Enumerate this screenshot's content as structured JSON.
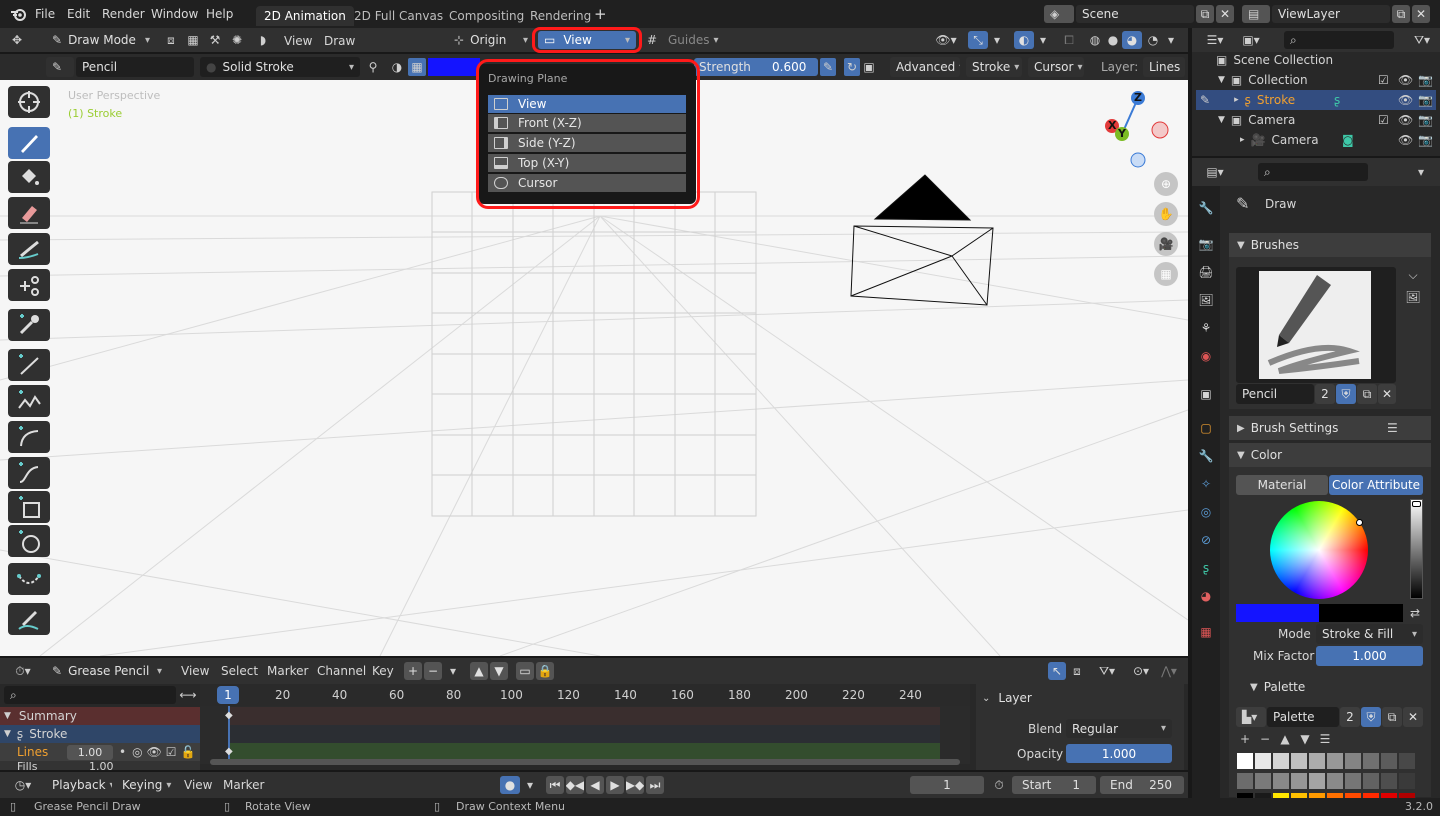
{
  "topbar": {
    "menus": [
      "File",
      "Edit",
      "Render",
      "Window",
      "Help"
    ],
    "workspaces": [
      "2D Animation",
      "2D Full Canvas",
      "Compositing",
      "Rendering"
    ],
    "plus": "+",
    "scene": "Scene",
    "view_layer": "ViewLayer"
  },
  "header": {
    "mode": "Draw Mode",
    "view": "View",
    "draw": "Draw",
    "origin": "Origin",
    "plane": "View",
    "guides": "Guides"
  },
  "tool_settings": {
    "brush": "Pencil",
    "material": "Solid Stroke",
    "strength_label": "Strength",
    "strength": "0.600",
    "advanced": "Advanced",
    "stroke": "Stroke",
    "cursor": "Cursor",
    "layer_label": "Layer:",
    "layer": "Lines"
  },
  "viewport": {
    "perspective": "User Perspective",
    "object": "(1) Stroke",
    "gizmo": {
      "z": "Z",
      "x": "X",
      "y": "Y"
    }
  },
  "drawing_plane": {
    "title": "Drawing Plane",
    "items": [
      {
        "label": "View",
        "icon": "monitor-icon"
      },
      {
        "label": "Front (X-Z)",
        "icon": "front-plane-icon"
      },
      {
        "label": "Side (Y-Z)",
        "icon": "side-plane-icon"
      },
      {
        "label": "Top (X-Y)",
        "icon": "top-plane-icon"
      },
      {
        "label": "Cursor",
        "icon": "cursor-target-icon"
      }
    ]
  },
  "outliner": {
    "root": "Scene Collection",
    "rows": [
      {
        "label": "Collection"
      },
      {
        "label": "Stroke"
      },
      {
        "label": "Camera"
      },
      {
        "label": "Camera"
      }
    ]
  },
  "properties": {
    "tool": "Draw",
    "brushes": "Brushes",
    "brush_name": "Pencil",
    "brush_users": "2",
    "brush_settings": "Brush Settings",
    "color": "Color",
    "tab_material": "Material",
    "tab_attribute": "Color Attribute",
    "mode_label": "Mode",
    "mode_value": "Stroke & Fill",
    "mix_label": "Mix Factor",
    "mix_value": "1.000",
    "palette": "Palette",
    "palette_name": "Palette",
    "palette_users": "2"
  },
  "timeline": {
    "editor": "Grease Pencil",
    "menus": [
      "View",
      "Select",
      "Marker",
      "Channel",
      "Key"
    ],
    "current_frame": "1",
    "ticks": [
      "20",
      "40",
      "60",
      "80",
      "100",
      "120",
      "140",
      "160",
      "180",
      "200",
      "220",
      "240"
    ],
    "channels": {
      "summary": "Summary",
      "stroke": "Stroke",
      "lines": "Lines",
      "lines_val": "1.00",
      "fills": "Fills",
      "fills_val": "1.00"
    },
    "layer_panel": {
      "title": "Layer",
      "blend_label": "Blend",
      "blend": "Regular",
      "opacity_label": "Opacity",
      "opacity": "1.000"
    }
  },
  "playback": {
    "playback": "Playback",
    "keying": "Keying",
    "view": "View",
    "marker": "Marker",
    "frame": "1",
    "start_label": "Start",
    "start": "1",
    "end_label": "End",
    "end": "250"
  },
  "statusbar": {
    "left": "Grease Pencil Draw",
    "mid": "Rotate View",
    "right": "Draw Context Menu",
    "version": "3.2.0"
  },
  "colors": {
    "accent": "#4772b3",
    "highlight": "#ff1a1a",
    "brush_color": "#1414ff",
    "active_orange": "#f0a030"
  }
}
